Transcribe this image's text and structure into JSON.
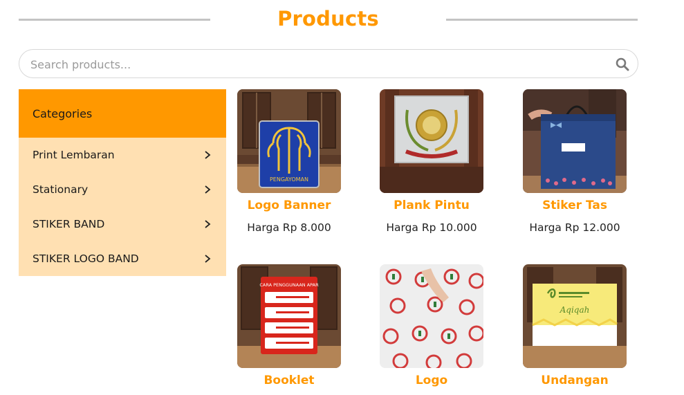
{
  "header": {
    "title": "Products"
  },
  "search": {
    "placeholder": "Search products..."
  },
  "sidebar": {
    "heading": "Categories",
    "items": [
      {
        "label": "Print Lembaran"
      },
      {
        "label": "Stationary"
      },
      {
        "label": "STIKER BAND"
      },
      {
        "label": "STIKER LOGO BAND"
      }
    ]
  },
  "products": [
    {
      "name": "Logo Banner",
      "price": "Harga Rp 8.000"
    },
    {
      "name": "Plank Pintu",
      "price": "Harga Rp 10.000"
    },
    {
      "name": "Stiker Tas",
      "price": "Harga Rp 12.000"
    },
    {
      "name": "Booklet",
      "price": ""
    },
    {
      "name": "Logo",
      "price": ""
    },
    {
      "name": "Undangan",
      "price": ""
    }
  ],
  "product_images": {
    "logo_banner_text": "PENGAYOMAN",
    "booklet_text": "CARA PENGGUNAAN APAR",
    "undangan_text": "Aqiqah"
  },
  "colors": {
    "accent": "#ff9800",
    "sidebar_bg": "#ffe0b2",
    "divider": "#c4c4c4"
  },
  "icons": {
    "search": "search-icon",
    "chevron": "chevron-right-icon"
  }
}
